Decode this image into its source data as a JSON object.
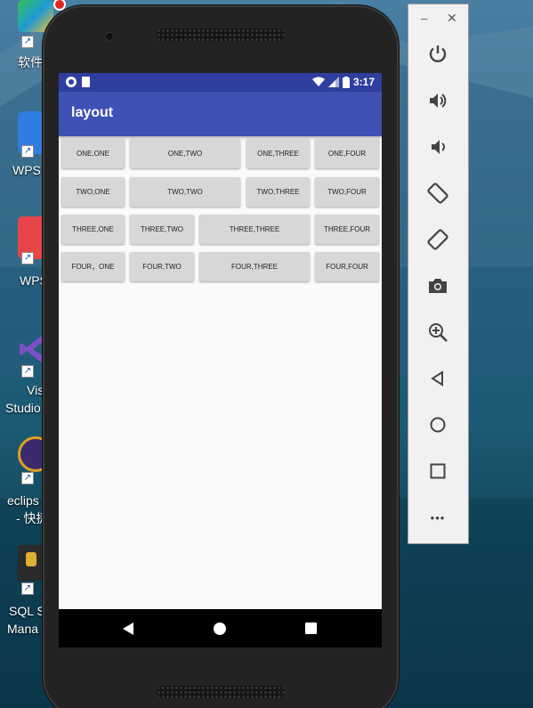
{
  "desktop": {
    "icons": [
      {
        "label": "软件",
        "color": "#2fb44a"
      },
      {
        "label": "WPS",
        "color": "#2f7de1"
      },
      {
        "label": "WPS",
        "color": "#e8454a"
      },
      {
        "label1": "Vis",
        "label2": "Studio",
        "color": "#7b4fc8"
      },
      {
        "label1": "eclips",
        "label2": "- 快捷",
        "color": "#3b2a6e"
      },
      {
        "label1": "SQL S",
        "label2": "Mana",
        "color": "#c9a12a"
      }
    ]
  },
  "status_bar": {
    "time": "3:17"
  },
  "app": {
    "title": "layout"
  },
  "grid": {
    "row1": [
      "ONE,ONE",
      "ONE,TWO",
      "ONE,THREE",
      "ONE,FOUR"
    ],
    "row2": [
      "TWO,ONE",
      "TWO,TWO",
      "TWO,THREE",
      "TWO,FOUR"
    ],
    "row3": [
      "THREE,ONE",
      "THREE,TWO",
      "THREE,THREE",
      "THREE,FOUR"
    ],
    "row4": [
      "FOUR，ONE",
      "FOUR,TWO",
      "FOUR,THREE",
      "FOUR,FOUR"
    ]
  },
  "emulator_toolbar": {
    "minimize": "–",
    "close": "✕",
    "buttons": [
      "power-icon",
      "volume-up-icon",
      "volume-down-icon",
      "rotate-left-icon",
      "rotate-right-icon",
      "camera-icon",
      "zoom-icon",
      "back-icon",
      "home-icon",
      "overview-icon",
      "more-icon"
    ],
    "more_label": "•••"
  },
  "colors": {
    "status_bar": "#303f9f",
    "app_bar": "#3f51b5",
    "button": "#d6d7d7"
  }
}
